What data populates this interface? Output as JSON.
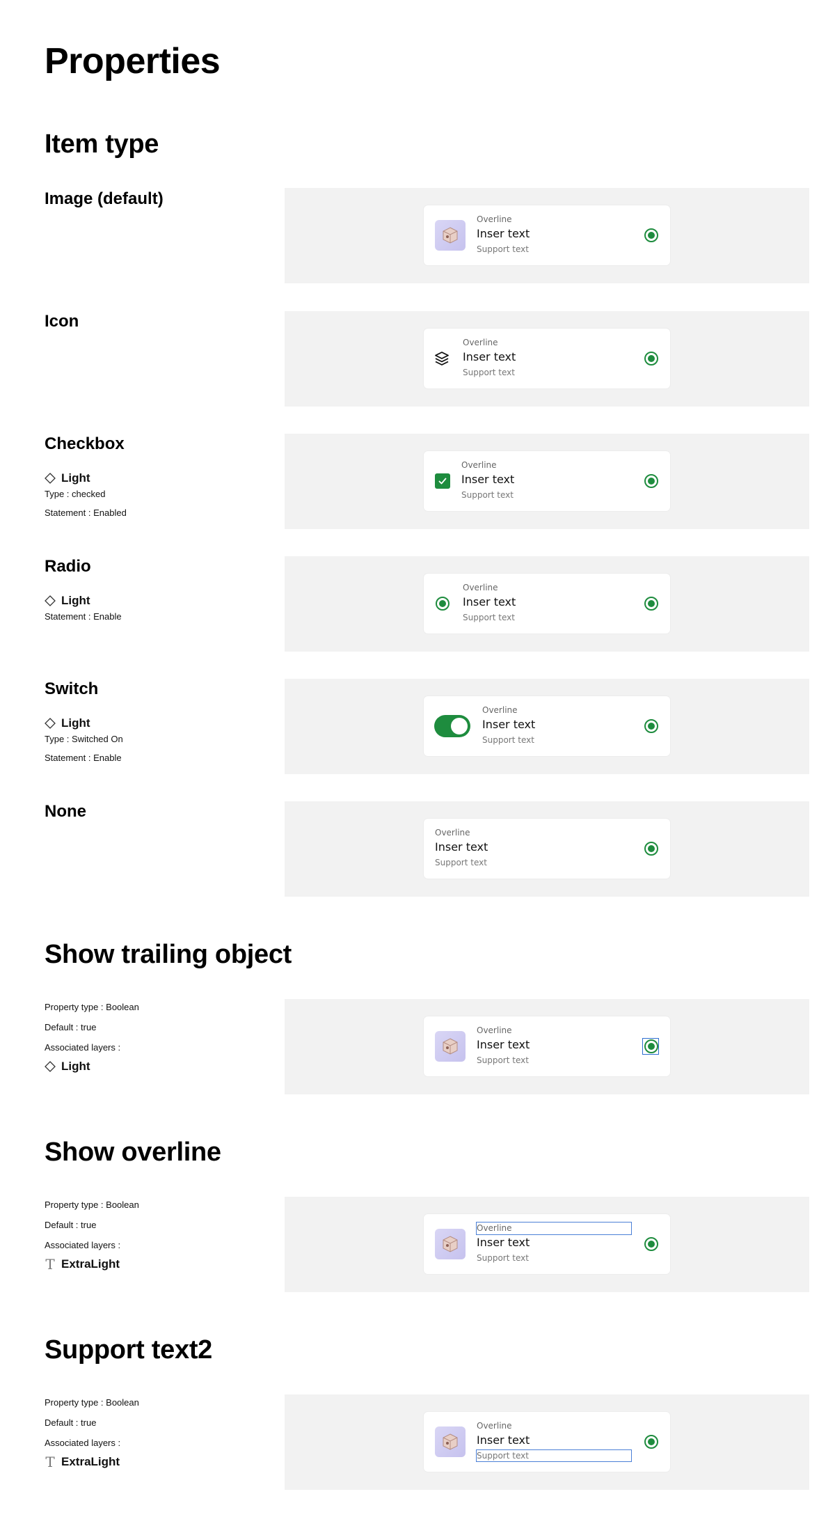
{
  "page": {
    "title": "Properties"
  },
  "colors": {
    "accent": "#1e8c3e",
    "stage_bg": "#f2f2f2",
    "selection_outline": "#4a7fd6"
  },
  "item_type": {
    "title": "Item type",
    "variants": [
      {
        "name": "Image (default)"
      },
      {
        "name": "Icon",
        "icon": "layers-icon"
      },
      {
        "name": "Checkbox",
        "badge": "Light",
        "props": [
          "Type : checked",
          "Statement : Enabled"
        ]
      },
      {
        "name": "Radio",
        "badge": "Light",
        "props": [
          "Statement : Enable"
        ]
      },
      {
        "name": "Switch",
        "badge": "Light",
        "props": [
          "Type : Switched On",
          "Statement : Enable"
        ]
      },
      {
        "name": "None"
      }
    ]
  },
  "list_item": {
    "overline": "Overline",
    "headline": "Inser text",
    "support": "Support text"
  },
  "show_trailing": {
    "title": "Show trailing object",
    "props": [
      "Property type : Boolean",
      "Default : true",
      "Associated layers :"
    ],
    "layer": "Light"
  },
  "show_overline": {
    "title": "Show overline",
    "props": [
      "Property type : Boolean",
      "Default : true",
      "Associated layers :"
    ],
    "layer": "ExtraLight"
  },
  "support_text2": {
    "title": "Support text2",
    "props": [
      "Property type : Boolean",
      "Default : true",
      "Associated layers :"
    ],
    "layer": "ExtraLight"
  }
}
